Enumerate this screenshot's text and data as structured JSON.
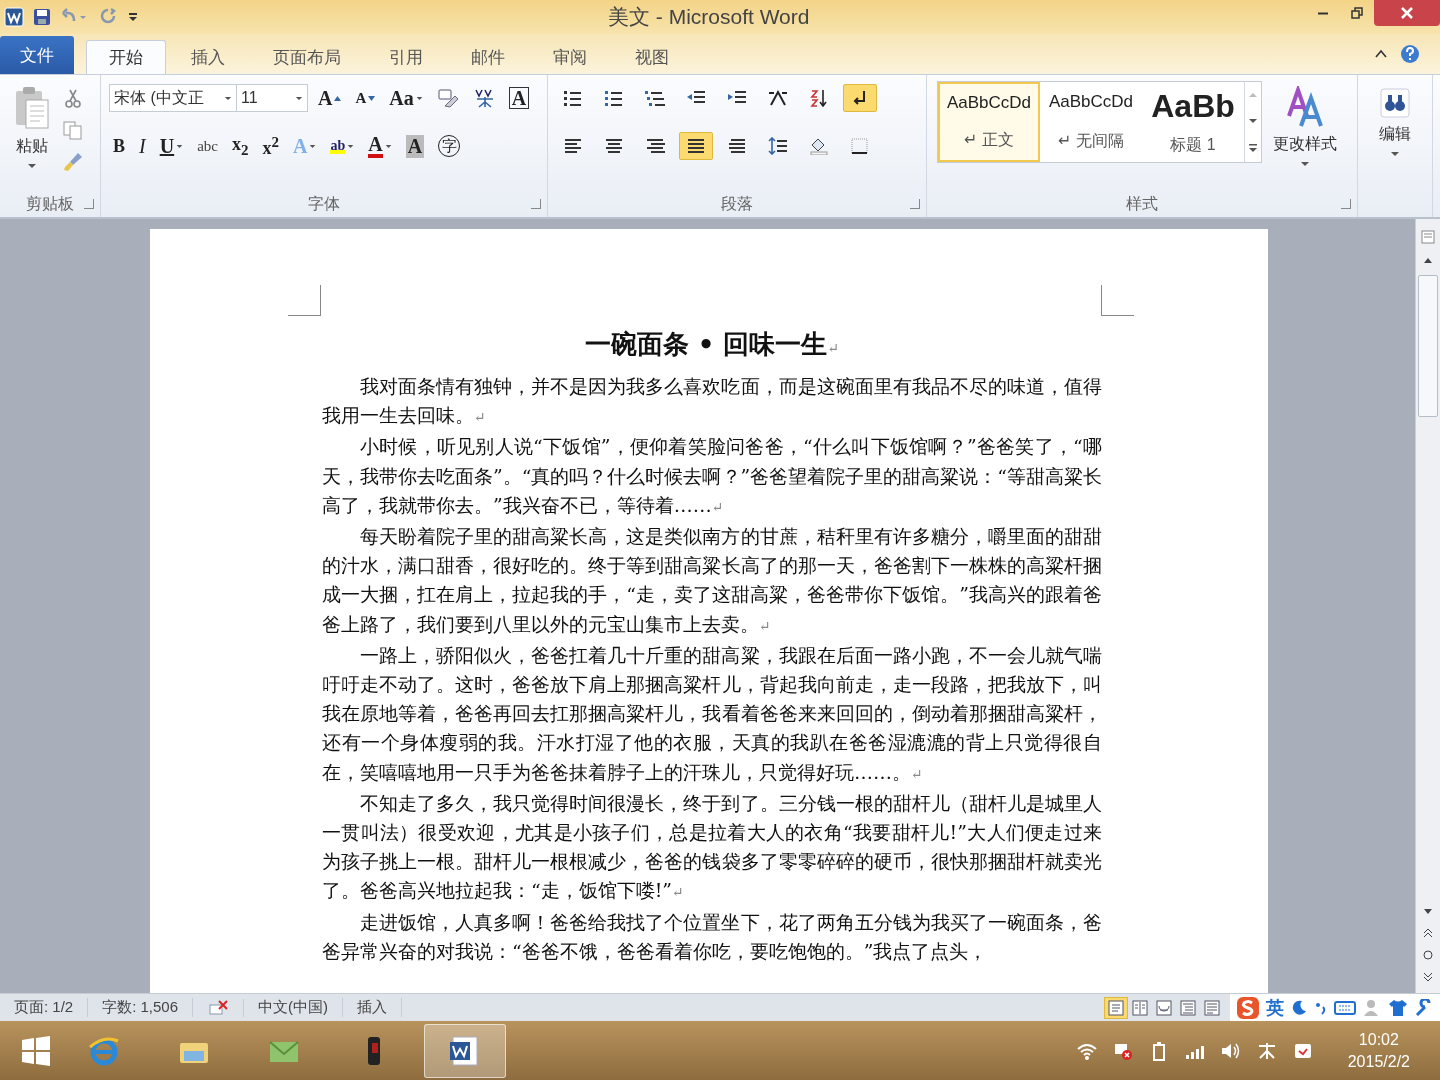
{
  "window": {
    "title": "美文 - Microsoft Word"
  },
  "tabs": [
    {
      "label": "文件",
      "kind": "file",
      "selected": false
    },
    {
      "label": "开始",
      "kind": "tab",
      "selected": true
    },
    {
      "label": "插入",
      "kind": "tab",
      "selected": false
    },
    {
      "label": "页面布局",
      "kind": "tab",
      "selected": false
    },
    {
      "label": "引用",
      "kind": "tab",
      "selected": false
    },
    {
      "label": "邮件",
      "kind": "tab",
      "selected": false
    },
    {
      "label": "审阅",
      "kind": "tab",
      "selected": false
    },
    {
      "label": "视图",
      "kind": "tab",
      "selected": false
    }
  ],
  "clipboard": {
    "paste": "粘贴",
    "group": "剪贴板"
  },
  "font": {
    "name": "宋体 (中文正",
    "size": "11",
    "group": "字体",
    "tools": [
      {
        "label": "A",
        "kind": "grow"
      },
      {
        "label": "A",
        "kind": "shrink"
      },
      {
        "label": "Aa",
        "kind": "case"
      },
      {
        "kind": "clear"
      },
      {
        "kind": "phonetic"
      },
      {
        "label": "A",
        "kind": "border"
      }
    ],
    "format": [
      {
        "label": "B",
        "kind": "bold",
        "dropdown": false
      },
      {
        "label": "I",
        "kind": "italic",
        "dropdown": false
      },
      {
        "label": "U",
        "kind": "underline",
        "dropdown": true
      },
      {
        "label": "abc",
        "kind": "strike",
        "dropdown": false
      },
      {
        "label": "x$_{2}$",
        "kind": "plain",
        "dropdown": false
      },
      {
        "label": "x$^{2}$",
        "kind": "plain",
        "dropdown": false
      },
      {
        "label": "A",
        "kind": "effect",
        "dropdown": true
      },
      {
        "label": "ab",
        "kind": "highlight",
        "dropdown": true
      },
      {
        "label": "A",
        "kind": "color",
        "dropdown": true
      },
      {
        "label": "A",
        "kind": "shade",
        "dropdown": false
      },
      {
        "label": "字",
        "kind": "enclose",
        "dropdown": false
      }
    ]
  },
  "paragraph": {
    "group": "段落",
    "row1": [
      {
        "kind": "bullets",
        "selected": false
      },
      {
        "kind": "numbering",
        "selected": false
      },
      {
        "kind": "multilevel",
        "selected": false
      },
      {
        "kind": "outdent",
        "selected": false
      },
      {
        "kind": "indent",
        "selected": false
      },
      {
        "kind": "cnlayout",
        "selected": false
      },
      {
        "kind": "sort",
        "selected": false
      },
      {
        "kind": "marks",
        "selected": true
      }
    ],
    "row2": [
      {
        "kind": "left",
        "selected": false
      },
      {
        "kind": "center",
        "selected": false
      },
      {
        "kind": "right",
        "selected": false
      },
      {
        "kind": "justify",
        "selected": true
      },
      {
        "kind": "distributed",
        "selected": false
      },
      {
        "kind": "spacing",
        "selected": false
      },
      {
        "kind": "shading",
        "selected": false
      },
      {
        "kind": "borders",
        "selected": false
      }
    ]
  },
  "styles": {
    "group": "样式",
    "items": [
      {
        "preview": "AaBbCcDd",
        "name": "↵ 正文",
        "kind": "normal",
        "selected": true
      },
      {
        "preview": "AaBbCcDd",
        "name": "↵ 无间隔",
        "kind": "normal",
        "selected": false
      },
      {
        "preview": "AaBb",
        "name": "标题 1",
        "kind": "heading",
        "selected": false
      }
    ],
    "change": "更改样式"
  },
  "editing": {
    "label": "编辑"
  },
  "document": {
    "title": "一碗面条 • 回味一生",
    "mark": "↵",
    "paragraphs": [
      "我对面条情有独钟，并不是因为我多么喜欢吃面，而是这碗面里有我品不尽的味道，值得我用一生去回味。",
      "小时候，听见别人说“下饭馆”，便仰着笑脸问爸爸，“什么叫下饭馆啊？”爸爸笑了，“哪天，我带你去吃面条”。“真的吗？什么时候去啊？”爸爸望着院子里的甜高粱说：“等甜高粱长高了，我就带你去。”我兴奋不已，等待着……",
      "每天盼着院子里的甜高粱长高，这是类似南方的甘蔗，秸秆里有许多糖分，嚼里面的甜甜的汁水，满口甜香，很好吃的。终于等到甜高粱长高了的那一天，爸爸割下一株株的高粱杆捆成一大捆，扛在肩上，拉起我的手，“走，卖了这甜高粱，爸爸带你下饭馆。”我高兴的跟着爸爸上路了，我们要到八里以外的元宝山集市上去卖。",
      "一路上，骄阳似火，爸爸扛着几十斤重的甜高粱，我跟在后面一路小跑，不一会儿就气喘吁吁走不动了。这时，爸爸放下肩上那捆高粱杆儿，背起我向前走，走一段路，把我放下，叫我在原地等着，爸爸再回去扛那捆高粱杆儿，我看着爸爸来来回回的，倒动着那捆甜高粱杆，还有一个身体瘦弱的我。汗水打湿了他的衣服，天真的我趴在爸爸湿漉漉的背上只觉得很自在，笑嘻嘻地用一只手为爸爸抹着脖子上的汗珠儿，只觉得好玩……。",
      "不知走了多久，我只觉得时间很漫长，终于到了。三分钱一根的甜杆儿（甜杆儿是城里人一贯叫法）很受欢迎，尤其是小孩子们，总是拉着大人的衣角“我要甜杆儿!”大人们便走过来为孩子挑上一根。甜杆儿一根根减少，爸爸的钱袋多了零零碎碎的硬币，很快那捆甜杆就卖光了。爸爸高兴地拉起我：“走，饭馆下喽!”",
      "走进饭馆，人真多啊！爸爸给我找了个位置坐下，花了两角五分钱为我买了一碗面条，爸爸异常兴奋的对我说：“爸爸不饿，爸爸看着你吃，要吃饱饱的。”我点了点头，"
    ]
  },
  "status_bar": [
    {
      "label": "页面: 1/2",
      "kind": "text"
    },
    {
      "label": "字数: 1,506",
      "kind": "text"
    },
    {
      "kind": "spell"
    },
    {
      "label": "中文(中国)",
      "kind": "text"
    },
    {
      "label": "插入",
      "kind": "text"
    }
  ],
  "views": [
    {
      "kind": "page",
      "selected": true
    },
    {
      "kind": "read",
      "selected": false
    },
    {
      "kind": "web",
      "selected": false
    },
    {
      "kind": "outline",
      "selected": false
    },
    {
      "kind": "draft",
      "selected": false
    }
  ],
  "ime": {
    "mode": "英"
  },
  "clock": {
    "time": "10:02",
    "date": "2015/2/2"
  }
}
